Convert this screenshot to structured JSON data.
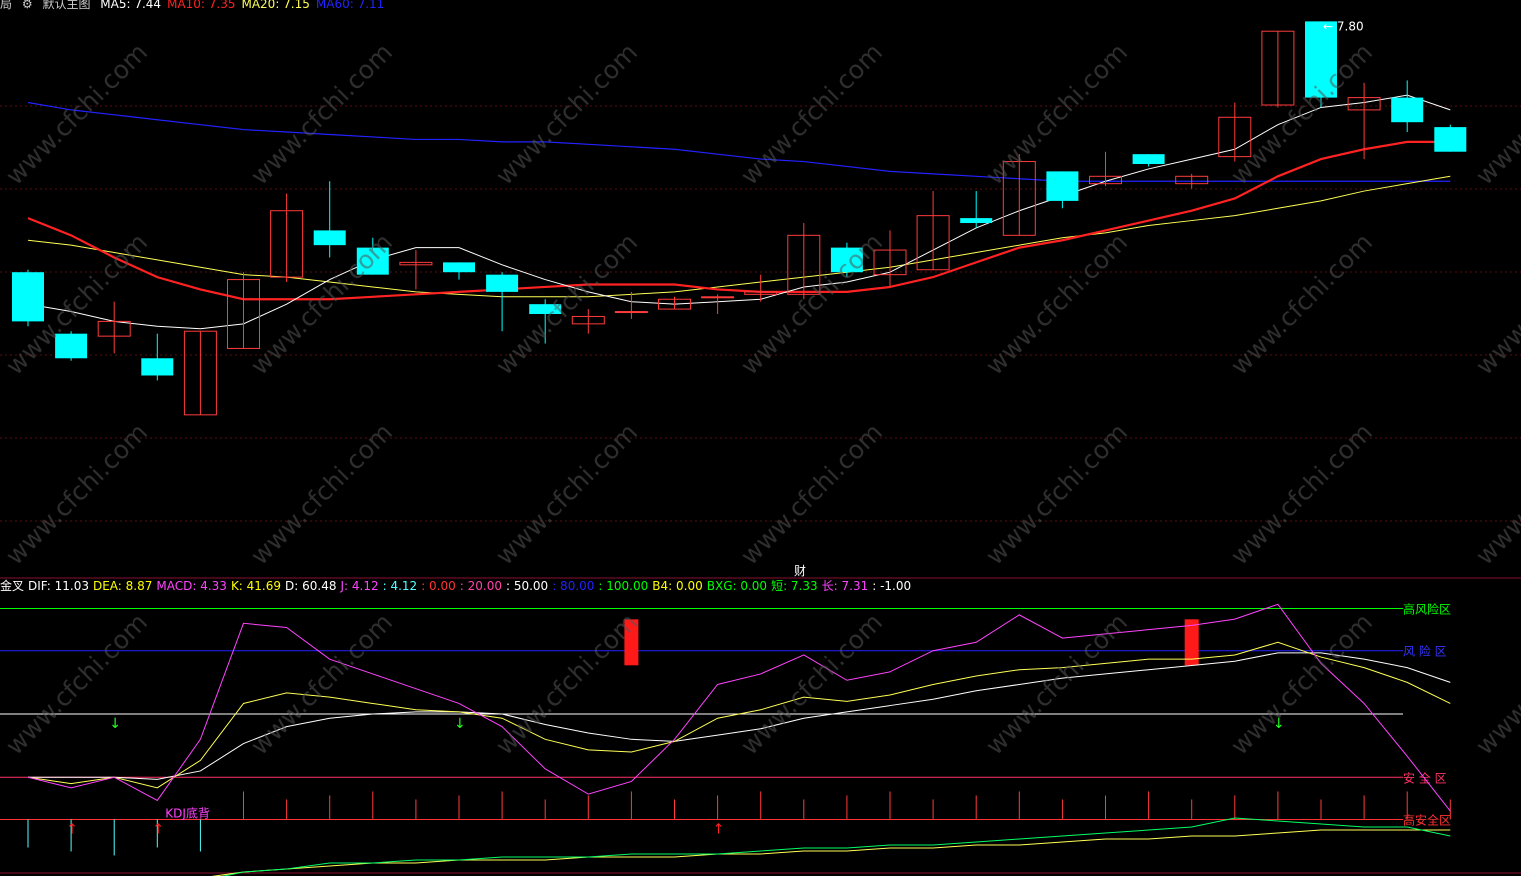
{
  "main_legend": {
    "icon_left": "局",
    "gear_icon": "gear-icon",
    "title": "默认主图",
    "items": [
      {
        "label": "MA5: 7.44",
        "color": "#ffffff"
      },
      {
        "label": "MA10: 7.35",
        "color": "#ff2222"
      },
      {
        "label": "MA20: 7.15",
        "color": "#ffff55"
      },
      {
        "label": "MA60: 7.11",
        "color": "#2222ff"
      }
    ]
  },
  "max_price_label": "7.80",
  "center_marker": "财",
  "sub_legend": {
    "items": [
      {
        "label": "金叉",
        "color": "#ffffff"
      },
      {
        "label": "DIF: 11.03",
        "color": "#ffffff"
      },
      {
        "label": "DEA: 8.87",
        "color": "#ffff00"
      },
      {
        "label": "MACD: 4.33",
        "color": "#ff44ff"
      },
      {
        "label": "K: 41.69",
        "color": "#ffff00"
      },
      {
        "label": "D: 60.48",
        "color": "#ffffff"
      },
      {
        "label": "J: 4.12",
        "color": "#ff44ff"
      },
      {
        "label": ": 4.12",
        "color": "#55ffff"
      },
      {
        "label": ": 0.00",
        "color": "#ff3333"
      },
      {
        "label": ": 20.00",
        "color": "#ff44aa"
      },
      {
        "label": ": 50.00",
        "color": "#ffffff"
      },
      {
        "label": ": 80.00",
        "color": "#2222ff"
      },
      {
        "label": ": 100.00",
        "color": "#00ff00"
      },
      {
        "label": "B4: 0.00",
        "color": "#ffff00"
      },
      {
        "label": "BXG: 0.00",
        "color": "#00ff00"
      },
      {
        "label": "短: 7.33",
        "color": "#00ff00"
      },
      {
        "label": "长: 7.31",
        "color": "#ff44ff"
      },
      {
        "label": ": -1.00",
        "color": "#ffffff"
      }
    ]
  },
  "zone_labels": [
    {
      "text": "高风险区",
      "color": "#00ff00"
    },
    {
      "text": "风 险 区",
      "color": "#3333ff"
    },
    {
      "text": "安 全 区",
      "color": "#ff3366"
    },
    {
      "text": "高安全区",
      "color": "#ff3333"
    }
  ],
  "signal_label": "KDJ底背",
  "watermark": "www.cfchi.com",
  "chart_data": {
    "type": "candlestick",
    "price_range": [
      5.65,
      7.85
    ],
    "candles": [
      {
        "o": 6.8,
        "h": 6.81,
        "l": 6.58,
        "c": 6.6
      },
      {
        "o": 6.55,
        "h": 6.56,
        "l": 6.44,
        "c": 6.45
      },
      {
        "o": 6.54,
        "h": 6.68,
        "l": 6.47,
        "c": 6.6
      },
      {
        "o": 6.45,
        "h": 6.55,
        "l": 6.36,
        "c": 6.38
      },
      {
        "o": 6.22,
        "h": 6.56,
        "l": 6.22,
        "c": 6.56
      },
      {
        "o": 6.49,
        "h": 6.8,
        "l": 6.49,
        "c": 6.77
      },
      {
        "o": 6.78,
        "h": 7.12,
        "l": 6.76,
        "c": 7.05
      },
      {
        "o": 6.97,
        "h": 7.17,
        "l": 6.86,
        "c": 6.91
      },
      {
        "o": 6.9,
        "h": 6.94,
        "l": 6.79,
        "c": 6.79
      },
      {
        "o": 6.83,
        "h": 6.89,
        "l": 6.73,
        "c": 6.84
      },
      {
        "o": 6.84,
        "h": 6.84,
        "l": 6.77,
        "c": 6.8
      },
      {
        "o": 6.79,
        "h": 6.8,
        "l": 6.56,
        "c": 6.72
      },
      {
        "o": 6.67,
        "h": 6.69,
        "l": 6.51,
        "c": 6.63
      },
      {
        "o": 6.59,
        "h": 6.65,
        "l": 6.55,
        "c": 6.62
      },
      {
        "o": 6.64,
        "h": 6.72,
        "l": 6.61,
        "c": 6.64
      },
      {
        "o": 6.65,
        "h": 6.7,
        "l": 6.65,
        "c": 6.69
      },
      {
        "o": 6.7,
        "h": 6.71,
        "l": 6.63,
        "c": 6.7
      },
      {
        "o": 6.71,
        "h": 6.79,
        "l": 6.68,
        "c": 6.72
      },
      {
        "o": 6.71,
        "h": 7.0,
        "l": 6.69,
        "c": 6.95
      },
      {
        "o": 6.9,
        "h": 6.92,
        "l": 6.78,
        "c": 6.8
      },
      {
        "o": 6.79,
        "h": 6.97,
        "l": 6.74,
        "c": 6.89
      },
      {
        "o": 6.81,
        "h": 7.13,
        "l": 6.81,
        "c": 7.03
      },
      {
        "o": 7.02,
        "h": 7.13,
        "l": 6.98,
        "c": 7.0
      },
      {
        "o": 6.95,
        "h": 7.28,
        "l": 6.95,
        "c": 7.25
      },
      {
        "o": 7.21,
        "h": 7.21,
        "l": 7.06,
        "c": 7.09
      },
      {
        "o": 7.16,
        "h": 7.29,
        "l": 7.15,
        "c": 7.19
      },
      {
        "o": 7.28,
        "h": 7.28,
        "l": 7.23,
        "c": 7.24
      },
      {
        "o": 7.16,
        "h": 7.2,
        "l": 7.14,
        "c": 7.19
      },
      {
        "o": 7.27,
        "h": 7.49,
        "l": 7.25,
        "c": 7.43
      },
      {
        "o": 7.48,
        "h": 7.78,
        "l": 7.47,
        "c": 7.78
      },
      {
        "o": 7.82,
        "h": 7.82,
        "l": 7.47,
        "c": 7.51
      },
      {
        "o": 7.46,
        "h": 7.57,
        "l": 7.26,
        "c": 7.51
      },
      {
        "o": 7.51,
        "h": 7.58,
        "l": 7.37,
        "c": 7.41
      },
      {
        "o": 7.39,
        "h": 7.4,
        "l": 7.29,
        "c": 7.29
      }
    ],
    "ma5": [
      6.67,
      6.64,
      6.6,
      6.58,
      6.57,
      6.59,
      6.67,
      6.77,
      6.85,
      6.9,
      6.9,
      6.83,
      6.77,
      6.72,
      6.68,
      6.67,
      6.68,
      6.69,
      6.74,
      6.76,
      6.8,
      6.89,
      6.98,
      7.05,
      7.11,
      7.17,
      7.22,
      7.26,
      7.3,
      7.4,
      7.47,
      7.49,
      7.52,
      7.46
    ],
    "ma10": [
      7.02,
      6.95,
      6.86,
      6.78,
      6.73,
      6.69,
      6.69,
      6.69,
      6.7,
      6.71,
      6.72,
      6.73,
      6.74,
      6.75,
      6.75,
      6.75,
      6.73,
      6.72,
      6.72,
      6.72,
      6.74,
      6.78,
      6.84,
      6.9,
      6.93,
      6.97,
      7.01,
      7.05,
      7.1,
      7.19,
      7.26,
      7.3,
      7.33,
      7.33
    ],
    "ma20": [
      6.93,
      6.91,
      6.88,
      6.85,
      6.82,
      6.79,
      6.78,
      6.76,
      6.74,
      6.72,
      6.71,
      6.7,
      6.7,
      6.7,
      6.71,
      6.72,
      6.74,
      6.76,
      6.78,
      6.8,
      6.82,
      6.85,
      6.88,
      6.91,
      6.94,
      6.96,
      6.99,
      7.01,
      7.03,
      7.06,
      7.09,
      7.13,
      7.16,
      7.19
    ],
    "ma60": [
      7.49,
      7.46,
      7.44,
      7.42,
      7.4,
      7.38,
      7.37,
      7.36,
      7.35,
      7.34,
      7.34,
      7.33,
      7.33,
      7.32,
      7.31,
      7.3,
      7.28,
      7.26,
      7.25,
      7.23,
      7.21,
      7.2,
      7.19,
      7.18,
      7.17,
      7.17,
      7.17,
      7.17,
      7.17,
      7.17,
      7.17,
      7.17,
      7.17,
      7.17
    ],
    "sub_range": [
      -5,
      105
    ],
    "sub_levels": [
      100,
      80,
      50,
      20,
      0
    ],
    "K": [
      20,
      17,
      20,
      15,
      28,
      55,
      60,
      58,
      55,
      52,
      51,
      48,
      38,
      33,
      32,
      37,
      48,
      52,
      58,
      56,
      59,
      64,
      68,
      71,
      72,
      74,
      76,
      76,
      78,
      84,
      77,
      72,
      65,
      55
    ],
    "D": [
      20,
      20,
      20,
      19,
      23,
      36,
      44,
      48,
      50,
      51,
      51,
      50,
      45,
      41,
      38,
      37,
      40,
      43,
      48,
      51,
      54,
      57,
      61,
      64,
      67,
      69,
      71,
      73,
      75,
      79,
      79,
      76,
      72,
      65
    ],
    "J": [
      20,
      15,
      20,
      9,
      38,
      93,
      91,
      76,
      69,
      62,
      55,
      44,
      24,
      12,
      18,
      38,
      64,
      69,
      78,
      66,
      70,
      80,
      84,
      97,
      86,
      88,
      90,
      92,
      95,
      102,
      74,
      55,
      30,
      4
    ],
    "bottom_long": [
      -10,
      -12,
      -13,
      -12,
      -10,
      -8,
      -7,
      -6,
      -5,
      -5,
      -4,
      -4,
      -4,
      -3,
      -3,
      -3,
      -2,
      -2,
      -1,
      -1,
      0,
      0,
      1,
      1,
      2,
      3,
      3,
      4,
      4,
      5,
      6,
      6,
      6,
      6
    ],
    "bottom_short": [
      -12,
      -15,
      -15,
      -13,
      -11,
      -8,
      -7,
      -5,
      -5,
      -4,
      -4,
      -3,
      -3,
      -3,
      -2,
      -2,
      -2,
      -1,
      0,
      0,
      1,
      1,
      2,
      3,
      4,
      5,
      6,
      7,
      10,
      9,
      8,
      7,
      7,
      4
    ],
    "bars": [
      {
        "index": 14,
        "label": "red"
      },
      {
        "index": 27,
        "label": "red"
      }
    ],
    "up_arrows": [
      1,
      3,
      16
    ],
    "down_arrows": [
      2,
      10,
      29
    ]
  }
}
